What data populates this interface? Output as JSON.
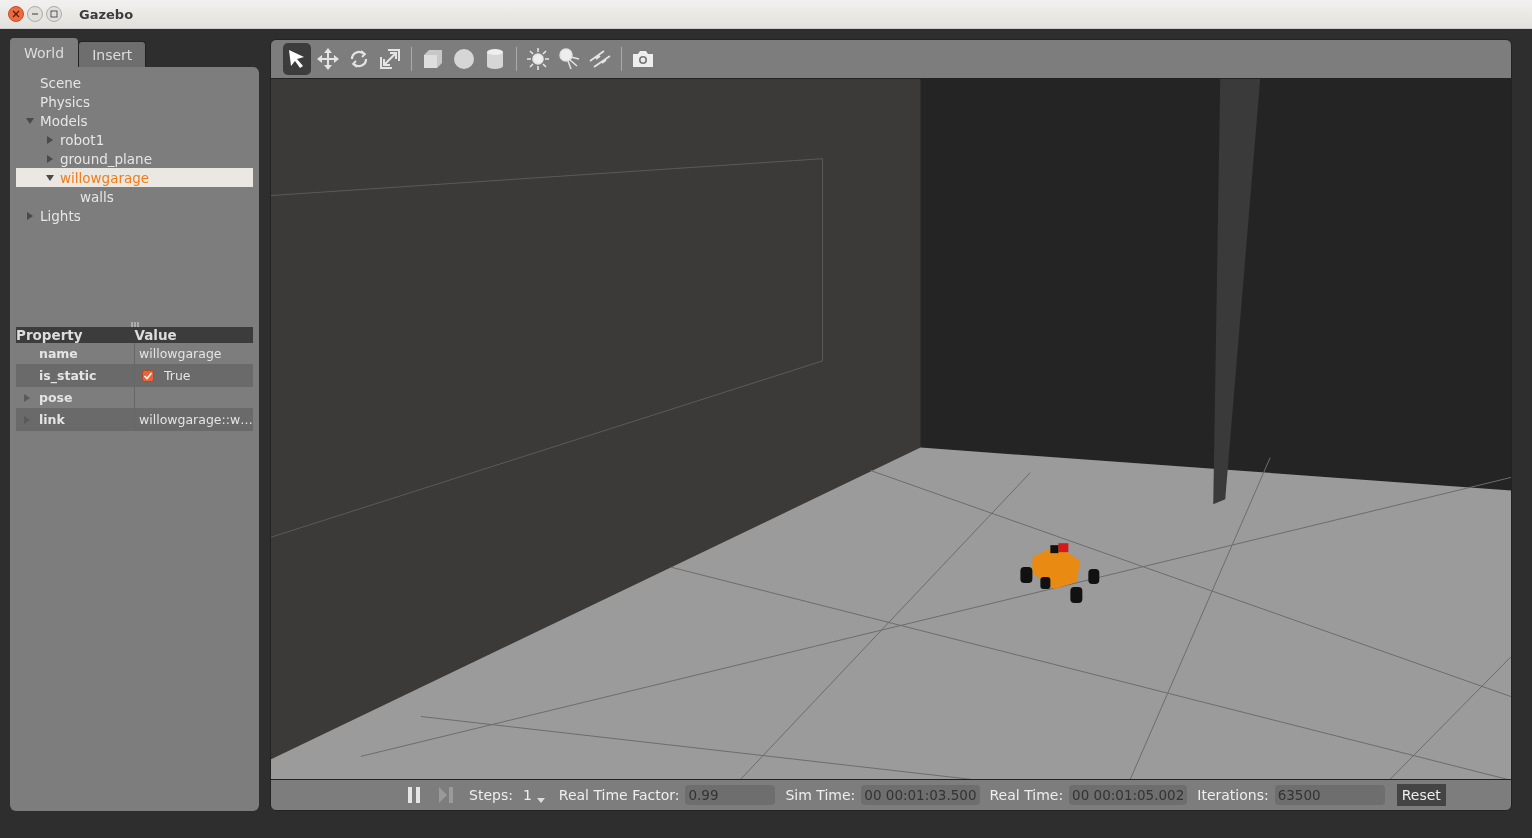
{
  "window": {
    "title": "Gazebo"
  },
  "tabs": [
    {
      "label": "World",
      "selected": true
    },
    {
      "label": "Insert",
      "selected": false
    }
  ],
  "tree": [
    {
      "label": "Scene",
      "kind": "leaf",
      "selected": false
    },
    {
      "label": "Physics",
      "kind": "leaf",
      "selected": false
    },
    {
      "label": "Models",
      "kind": "group",
      "expanded": true,
      "selected": false,
      "children": [
        {
          "label": "robot1",
          "kind": "group",
          "expanded": false,
          "selected": false
        },
        {
          "label": "ground_plane",
          "kind": "group",
          "expanded": false,
          "selected": false
        },
        {
          "label": "willowgarage",
          "kind": "group",
          "expanded": true,
          "selected": true,
          "children": [
            {
              "label": "walls",
              "kind": "leaf",
              "selected": false
            }
          ]
        }
      ]
    },
    {
      "label": "Lights",
      "kind": "group",
      "expanded": false,
      "selected": false
    }
  ],
  "properties": {
    "columns": [
      "Property",
      "Value"
    ],
    "rows": [
      {
        "name": "name",
        "kind": "text",
        "value": "willowgarage"
      },
      {
        "name": "is_static",
        "kind": "checkbox",
        "checked": true,
        "value": "True"
      },
      {
        "name": "pose",
        "kind": "group",
        "expanded": false
      },
      {
        "name": "link",
        "kind": "group",
        "expanded": false,
        "value": "willowgarage::w…"
      }
    ]
  },
  "toolbar": [
    {
      "kind": "select",
      "selected": true
    },
    {
      "kind": "translate",
      "selected": false
    },
    {
      "kind": "rotate",
      "selected": false
    },
    {
      "kind": "scale",
      "selected": false
    },
    {
      "kind": "separator"
    },
    {
      "kind": "box",
      "selected": false
    },
    {
      "kind": "sphere",
      "selected": false
    },
    {
      "kind": "cylinder",
      "selected": false
    },
    {
      "kind": "separator"
    },
    {
      "kind": "point-light",
      "selected": false
    },
    {
      "kind": "spot-light",
      "selected": false
    },
    {
      "kind": "directional-light",
      "selected": false
    },
    {
      "kind": "separator"
    },
    {
      "kind": "screenshot",
      "selected": false
    }
  ],
  "status_bar": {
    "steps_label": "Steps:",
    "steps": "1",
    "fields": [
      {
        "label": "Real Time Factor:",
        "value": "0.99"
      },
      {
        "label": "Sim Time:",
        "value": "00 00:01:03.500"
      },
      {
        "label": "Real Time:",
        "value": "00 00:01:05.002"
      },
      {
        "label": "Iterations:",
        "value": "63500"
      }
    ],
    "reset": "Reset"
  }
}
